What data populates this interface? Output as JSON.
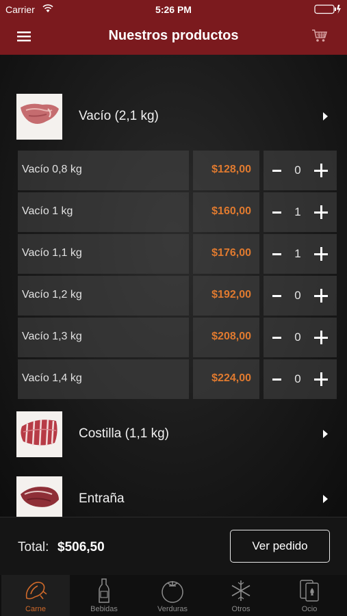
{
  "status_bar": {
    "carrier": "Carrier",
    "time": "5:26 PM"
  },
  "nav": {
    "title": "Nuestros productos"
  },
  "products": [
    {
      "name": "Vacío  (2,1 kg)"
    },
    {
      "name": "Costilla  (1,1 kg)"
    },
    {
      "name": "Entraña"
    }
  ],
  "variants": [
    {
      "label": "Vacío 0,8 kg",
      "price": "$128,00",
      "qty": "0"
    },
    {
      "label": "Vacío 1 kg",
      "price": "$160,00",
      "qty": "1"
    },
    {
      "label": "Vacío 1,1 kg",
      "price": "$176,00",
      "qty": "1"
    },
    {
      "label": "Vacío 1,2 kg",
      "price": "$192,00",
      "qty": "0"
    },
    {
      "label": "Vacío 1,3 kg",
      "price": "$208,00",
      "qty": "0"
    },
    {
      "label": "Vacío 1,4 kg",
      "price": "$224,00",
      "qty": "0"
    }
  ],
  "footer": {
    "total_label": "Total:",
    "total_value": "$506,50",
    "order_button": "Ver pedido"
  },
  "tabs": [
    {
      "label": "Carne",
      "icon": "steak-icon",
      "active": true
    },
    {
      "label": "Bebidas",
      "icon": "bottle-icon",
      "active": false
    },
    {
      "label": "Verduras",
      "icon": "tomato-icon",
      "active": false
    },
    {
      "label": "Otros",
      "icon": "snowflake-icon",
      "active": false
    },
    {
      "label": "Ocio",
      "icon": "cards-icon",
      "active": false
    }
  ],
  "colors": {
    "brand": "#7b1a1e",
    "price": "#e07a2f",
    "active_tab": "#d06a2a"
  }
}
